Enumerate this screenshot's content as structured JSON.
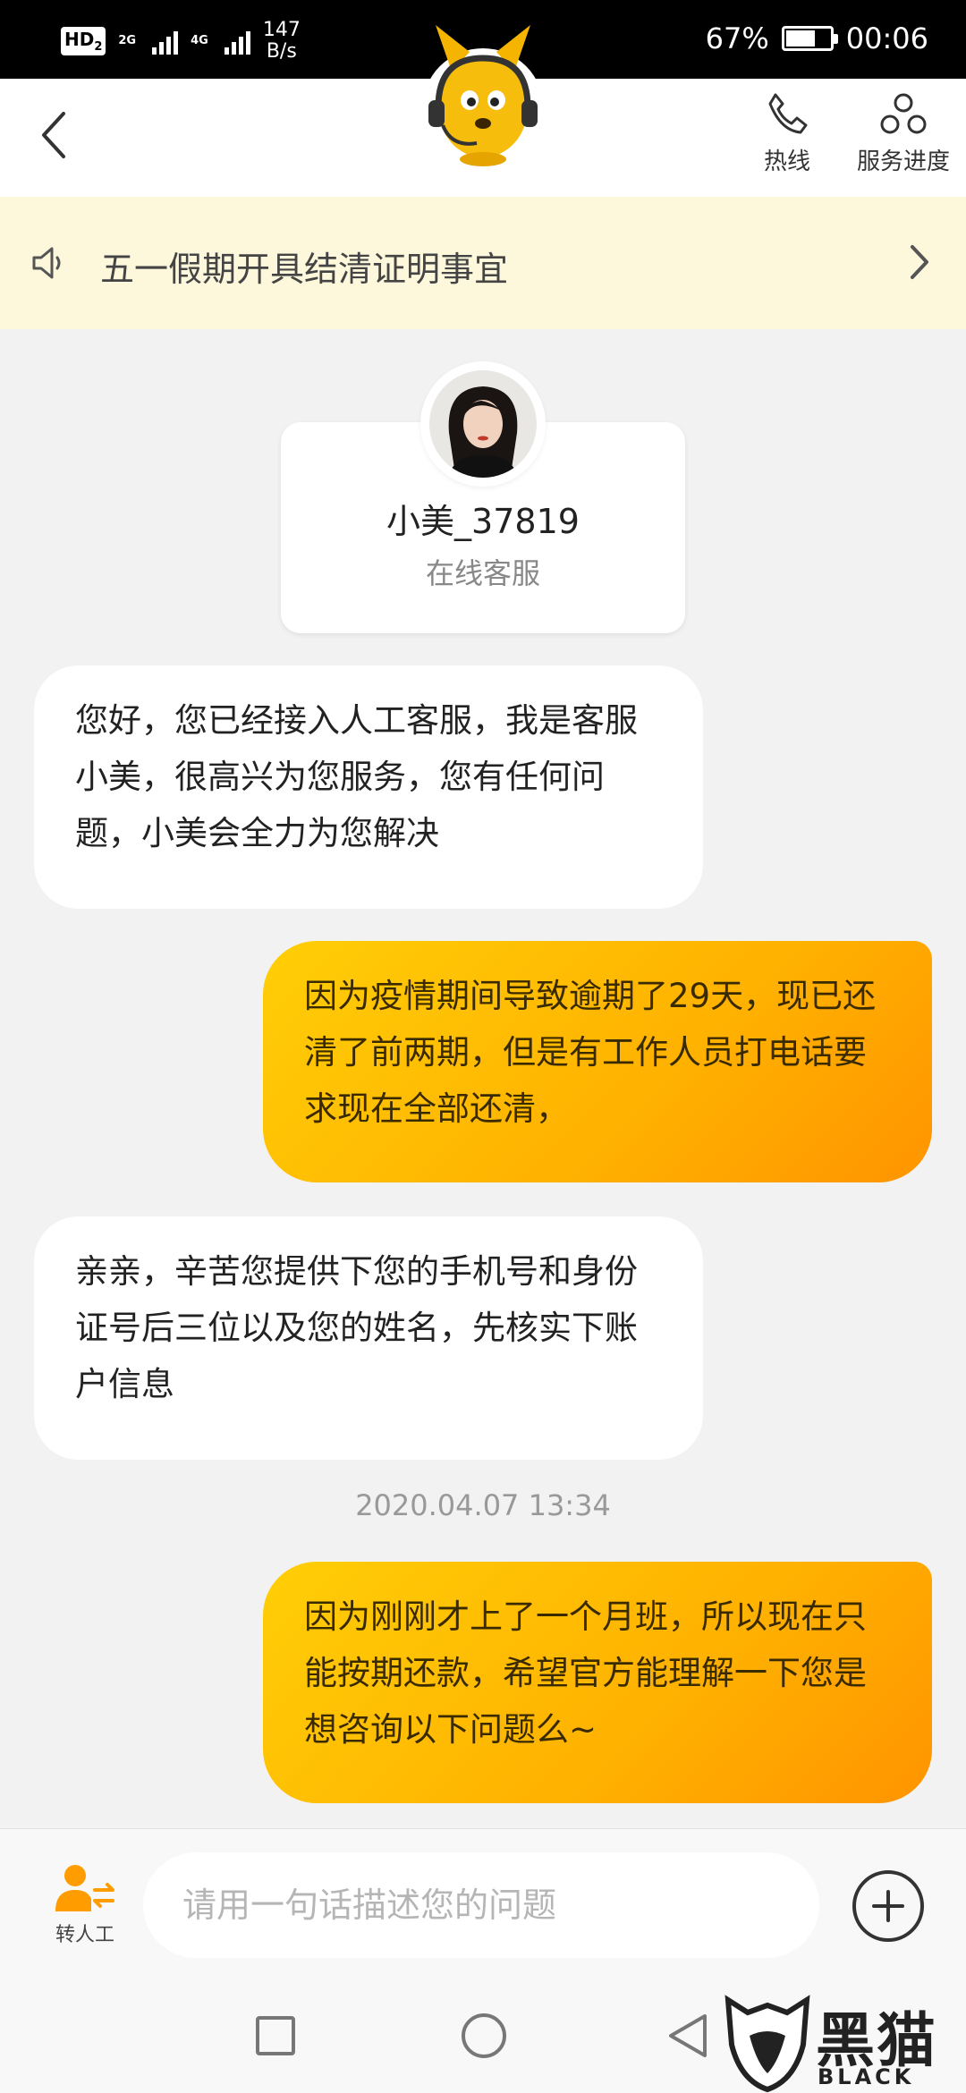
{
  "status_bar": {
    "hd_badge": "HD",
    "hd_sub": "2",
    "net1": "2G",
    "net2": "4G",
    "speed_value": "147",
    "speed_unit": "B/s",
    "battery": "67%",
    "battery_level": 0.67,
    "time": "00:06"
  },
  "header": {
    "hotline_label": "热线",
    "progress_label": "服务进度"
  },
  "notice": {
    "text": "五一假期开具结清证明事宜"
  },
  "agent": {
    "name": "小美_37819",
    "role": "在线客服"
  },
  "messages": [
    {
      "side": "left",
      "text": "您好，您已经接入人工客服，我是客服小美，很高兴为您服务，您有任何问题，小美会全力为您解决"
    },
    {
      "side": "right",
      "text": "因为疫情期间导致逾期了29天，现已还清了前两期，但是有工作人员打电话要求现在全部还清，"
    },
    {
      "side": "left",
      "text": "亲亲，辛苦您提供下您的手机号和身份证号后三位以及您的姓名，先核实下账户信息"
    },
    {
      "side": "right",
      "text": "因为刚刚才上了一个月班，所以现在只能按期还款，希望官方能理解一下您是想咨询以下问题么~"
    }
  ],
  "timestamp": "2020.04.07 13:34",
  "input_bar": {
    "transfer_label": "转人工",
    "placeholder": "请用一句话描述您的问题"
  },
  "watermark": {
    "text": "黑猫",
    "sub": "BLACK CAT"
  },
  "colors": {
    "accent": "#ffb100",
    "notice_bg": "#fdf7dc"
  }
}
